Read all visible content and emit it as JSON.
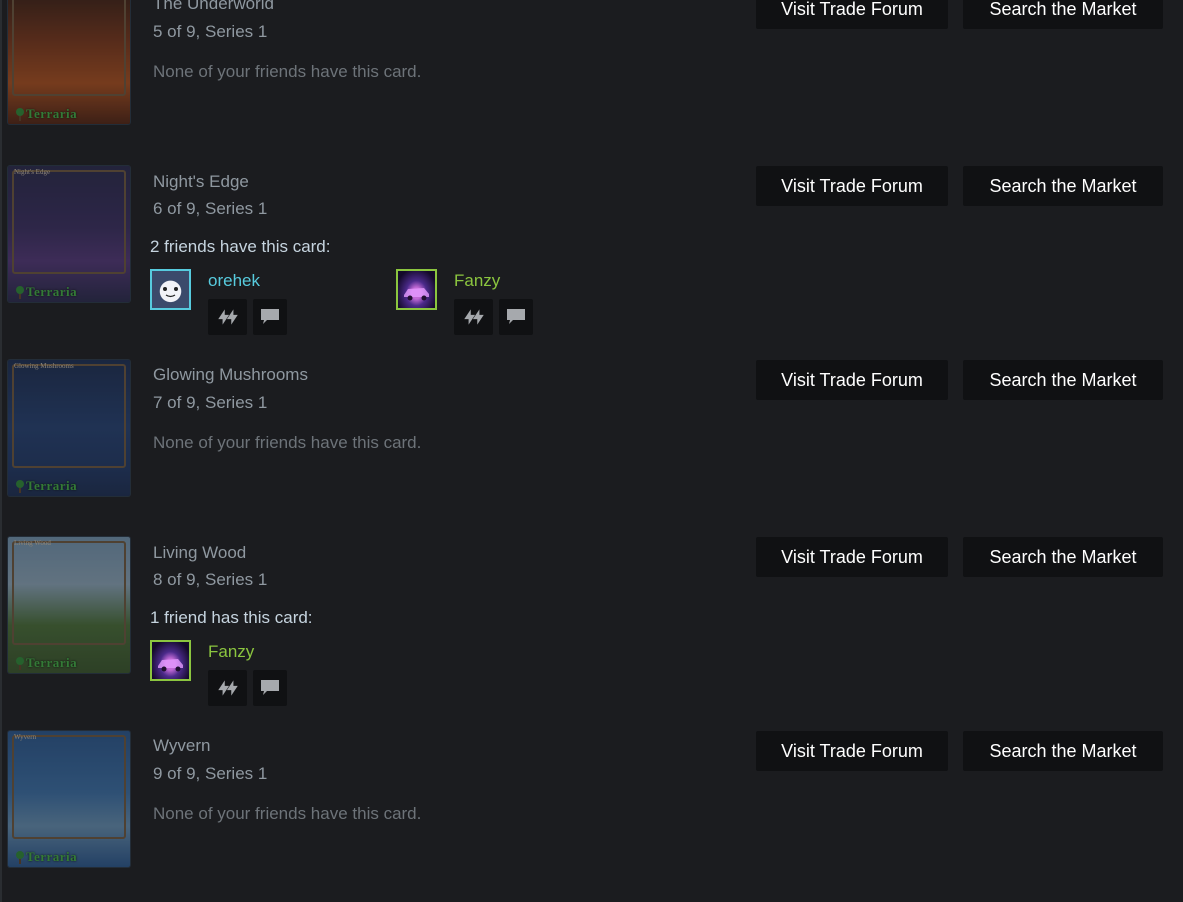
{
  "buttons": {
    "forum": "Visit Trade Forum",
    "market": "Search the Market"
  },
  "logo_text": "Terraria",
  "cards": [
    {
      "name": "The Underworld",
      "progress": "5 of 9, Series 1",
      "art_label": "",
      "status": "None of your friends have this card."
    },
    {
      "name": "Night's Edge",
      "progress": "6 of 9, Series 1",
      "art_label": "Night's Edge",
      "status": "2 friends have this card:"
    },
    {
      "name": "Glowing Mushrooms",
      "progress": "7 of 9, Series 1",
      "art_label": "Glowing Mushrooms",
      "status": "None of your friends have this card."
    },
    {
      "name": "Living Wood",
      "progress": "8 of 9, Series 1",
      "art_label": "Living Wood",
      "status": "1 friend has this card:"
    },
    {
      "name": "Wyvern",
      "progress": "9 of 9, Series 1",
      "art_label": "Wyvern",
      "status": "None of your friends have this card."
    }
  ],
  "friends": {
    "nights_edge": [
      {
        "name": "orehek",
        "state": "online"
      },
      {
        "name": "Fanzy",
        "state": "in-game"
      }
    ],
    "living_wood": [
      {
        "name": "Fanzy",
        "state": "in-game"
      }
    ]
  },
  "icons": {
    "trade": "trade-arrows-icon",
    "chat": "chat-bubble-icon"
  },
  "colors": {
    "online": "#57cbde",
    "ingame": "#8bc53f",
    "button_bg": "#101113",
    "page_bg": "#1b1c1f"
  }
}
